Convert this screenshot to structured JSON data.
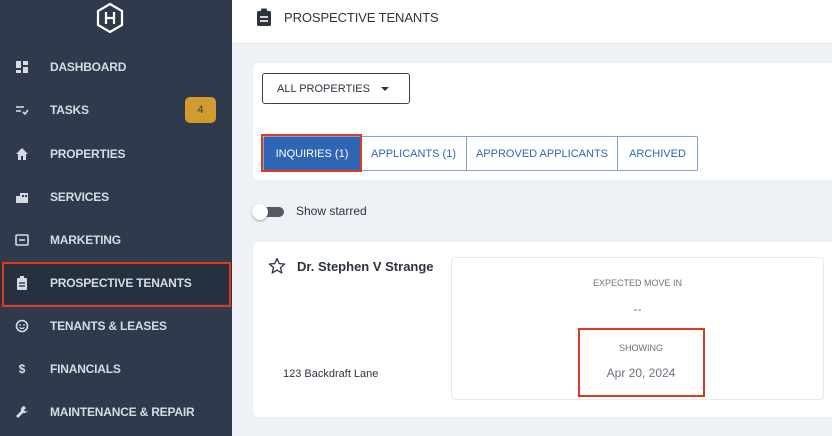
{
  "sidebar": {
    "items": [
      {
        "label": "DASHBOARD",
        "icon": "dashboard-icon"
      },
      {
        "label": "TASKS",
        "icon": "tasks-icon",
        "badge": "4"
      },
      {
        "label": "PROPERTIES",
        "icon": "home-icon"
      },
      {
        "label": "SERVICES",
        "icon": "services-icon"
      },
      {
        "label": "MARKETING",
        "icon": "marketing-icon"
      },
      {
        "label": "PROSPECTIVE TENANTS",
        "icon": "clipboard-icon"
      },
      {
        "label": "TENANTS & LEASES",
        "icon": "tenants-icon"
      },
      {
        "label": "FINANCIALS",
        "icon": "dollar-icon"
      },
      {
        "label": "MAINTENANCE & REPAIR",
        "icon": "wrench-icon"
      }
    ],
    "active_item": "PROSPECTIVE TENANTS"
  },
  "header": {
    "title": "PROSPECTIVE TENANTS",
    "icon": "clipboard-icon"
  },
  "filter": {
    "property_dropdown": "ALL PROPERTIES"
  },
  "tabs": [
    {
      "label": "INQUIRIES (1)",
      "active": true
    },
    {
      "label": "APPLICANTS (1)",
      "active": false
    },
    {
      "label": "APPROVED APPLICANTS",
      "active": false
    },
    {
      "label": "ARCHIVED",
      "active": false
    }
  ],
  "toggle": {
    "label": "Show starred",
    "on": false
  },
  "tenant": {
    "name": "Dr. Stephen V Strange",
    "address": "123 Backdraft Lane",
    "starred": false,
    "expected_move_in_label": "EXPECTED MOVE IN",
    "expected_move_in_value": "--",
    "showing_label": "SHOWING",
    "showing_value": "Apr 20, 2024"
  },
  "colors": {
    "sidebar_bg": "#2f3b4c",
    "accent_blue": "#2f66b3",
    "badge": "#d19b2e",
    "highlight_red": "#e0391f"
  }
}
